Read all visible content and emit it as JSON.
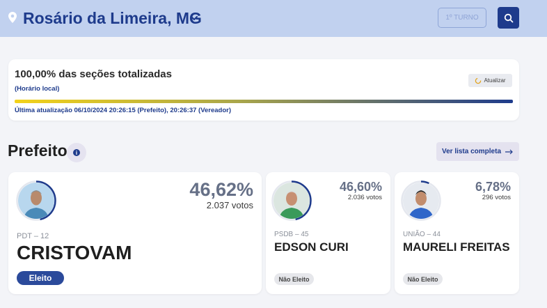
{
  "header": {
    "location_icon": "location-pin-icon",
    "city": "Rosário da Limeira, MG",
    "round_label": "1º TURNO",
    "search_icon": "search-icon"
  },
  "status": {
    "title": "100,00% das seções totalizadas",
    "subtitle": "(Horário local)",
    "update_button": "Atualizar",
    "progress_percent": 100,
    "last_update": "Última atualização 06/10/2024 20:26:15 (Prefeito), 20:26:37 (Vereador)"
  },
  "section": {
    "title": "Prefeito",
    "info_glyph": "i",
    "list_button": "Ver lista completa"
  },
  "candidates": [
    {
      "party": "PDT – 12",
      "name": "CRISTOVAM",
      "percent": "46,62%",
      "votes": "2.037 votos",
      "status": "Eleito",
      "share": 0.4662
    },
    {
      "party": "PSDB – 45",
      "name": "EDSON CURI",
      "percent": "46,60%",
      "votes": "2.036 votos",
      "status": "Não Eleito",
      "share": 0.466
    },
    {
      "party": "UNIÃO – 44",
      "name": "MAURELI FREITAS",
      "percent": "6,78%",
      "votes": "296 votos",
      "status": "Não Eleito",
      "share": 0.0678
    }
  ],
  "colors": {
    "brand": "#1e3b8c",
    "header_bg": "#c1d1ef",
    "progress_start": "#f3d21a",
    "progress_end": "#1e3b8c"
  }
}
